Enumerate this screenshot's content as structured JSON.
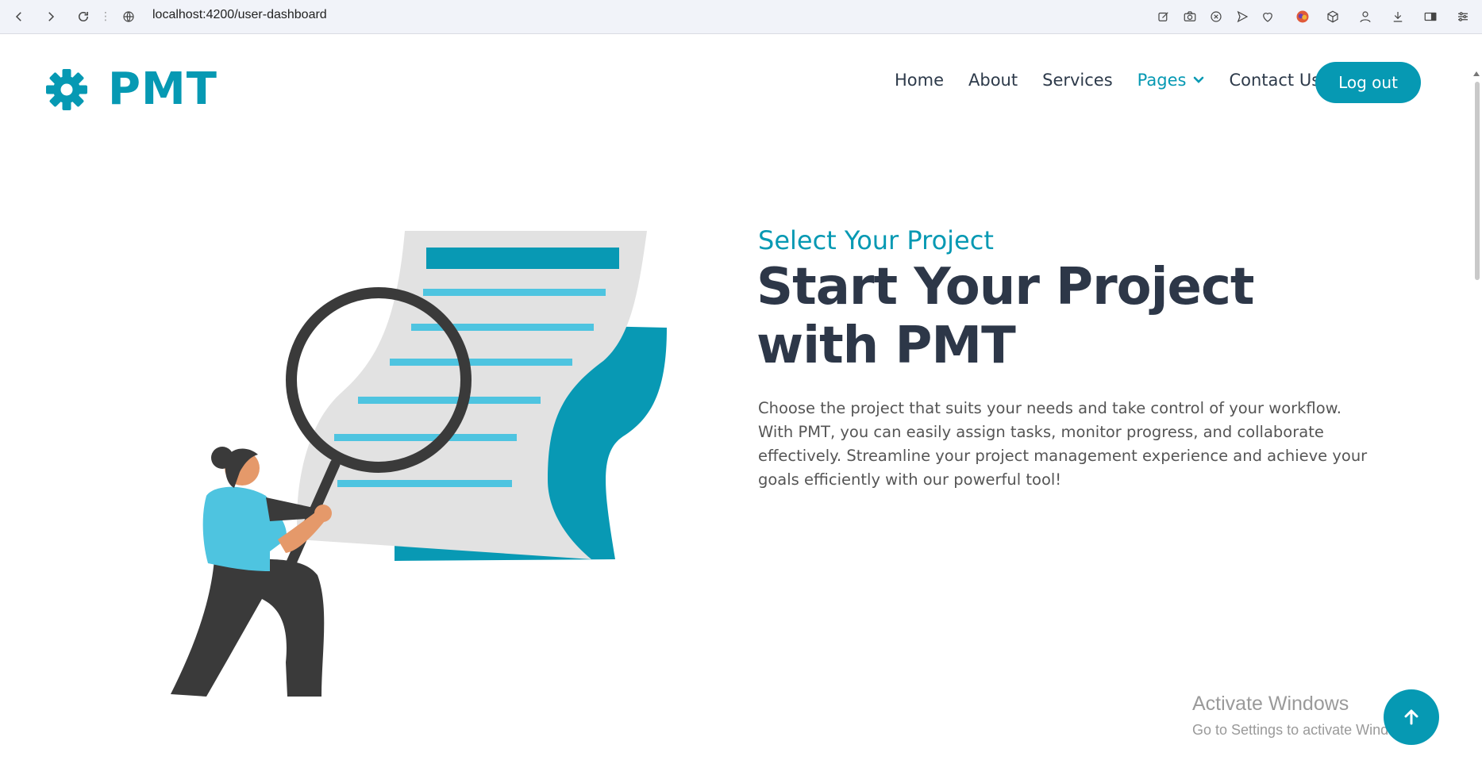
{
  "browser": {
    "url": "localhost:4200/user-dashboard",
    "icons": [
      "back-icon",
      "forward-icon",
      "reload-icon",
      "site-info-icon",
      "edit-icon",
      "camera-icon",
      "close-circle-icon",
      "send-icon",
      "heart-icon",
      "extension-avatar-icon",
      "cube-icon",
      "profile-icon",
      "download-icon",
      "sidebar-icon",
      "settings-icon"
    ]
  },
  "brand": {
    "name": "PMT",
    "icon": "gear-icon",
    "color": "#0699b3"
  },
  "nav": {
    "items": [
      "Home",
      "About",
      "Services",
      "Pages",
      "Contact Us"
    ],
    "logout_label": "Log out"
  },
  "hero": {
    "subtitle": "Select Your Project",
    "headline": "Start Your Project with PMT",
    "description": "Choose the project that suits your needs and take control of your workflow. With PMT, you can easily assign tasks, monitor progress, and collaborate effectively. Streamline your project management experience and achieve your goals efficiently with our powerful tool!"
  },
  "watermark": {
    "title": "Activate Windows",
    "subtitle": "Go to Settings to activate Windows."
  },
  "back_to_top": {
    "icon": "arrow-up-icon"
  },
  "colors": {
    "accent": "#0699b3",
    "heading": "#2d3748",
    "body_text": "#555555"
  }
}
